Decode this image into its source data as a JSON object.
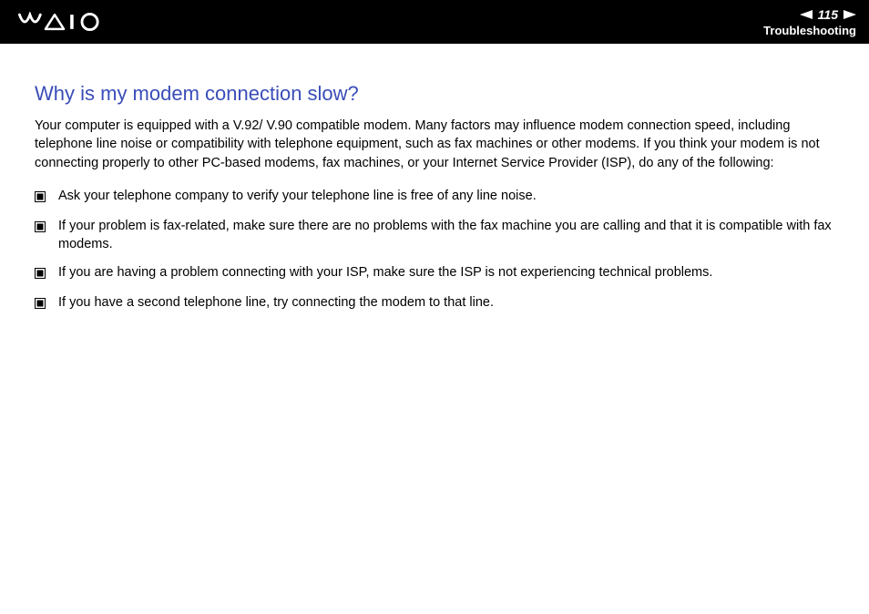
{
  "header": {
    "pageNumber": "115",
    "sectionTitle": "Troubleshooting"
  },
  "content": {
    "heading": "Why is my modem connection slow?",
    "intro": "Your computer is equipped with a V.92/ V.90 compatible modem. Many factors may influence modem connection speed, including telephone line noise or compatibility with telephone equipment, such as fax machines or other modems. If you think your modem is not connecting properly to other PC-based modems, fax machines, or your Internet Service Provider (ISP), do any of the following:",
    "bullets": [
      "Ask your telephone company to verify your telephone line is free of any line noise.",
      "If your problem is fax-related, make sure there are no problems with the fax machine you are calling and that it is compatible with fax modems.",
      "If you are having a problem connecting with your ISP, make sure the ISP is not experiencing technical problems.",
      "If you have a second telephone line, try connecting the modem to that line."
    ]
  }
}
